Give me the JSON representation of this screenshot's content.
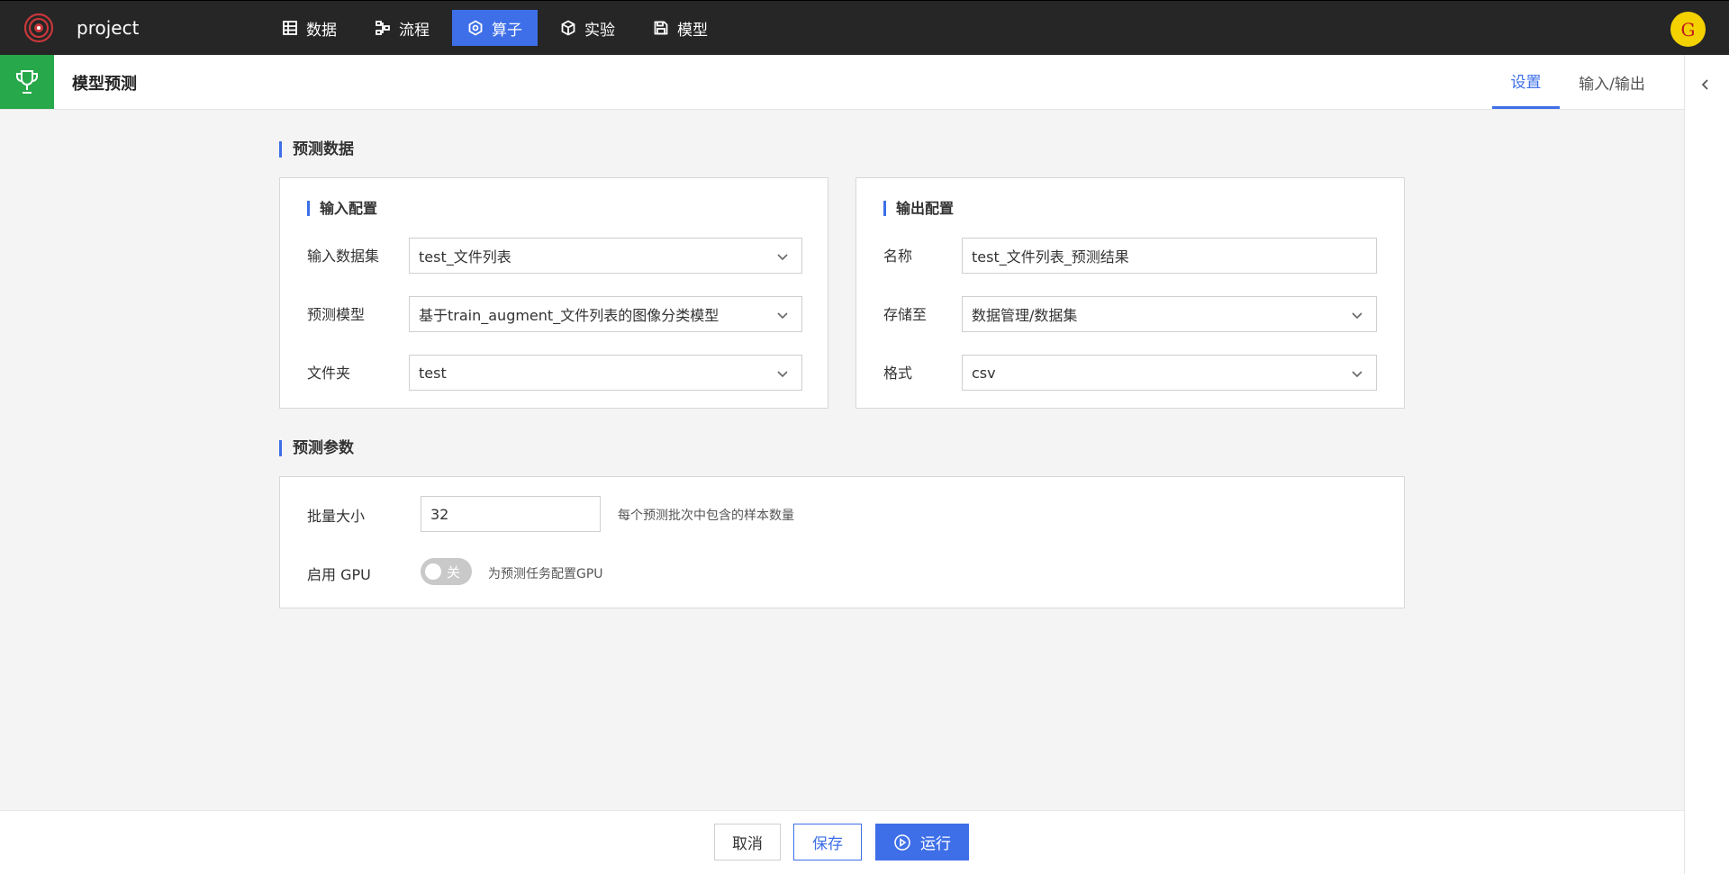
{
  "app": {
    "project_name": "project",
    "avatar_letter": "G"
  },
  "nav": {
    "items": [
      {
        "label": "数据",
        "icon": "table-icon"
      },
      {
        "label": "流程",
        "icon": "flow-icon"
      },
      {
        "label": "算子",
        "icon": "hexagon-icon",
        "active": true
      },
      {
        "label": "实验",
        "icon": "cube-icon"
      },
      {
        "label": "模型",
        "icon": "save-icon"
      }
    ]
  },
  "header": {
    "title": "模型预测",
    "tabs": {
      "settings": "设置",
      "io": "输入/输出"
    }
  },
  "predict_data": {
    "section_title": "预测数据",
    "input_config": {
      "title": "输入配置",
      "dataset_label": "输入数据集",
      "dataset_value": "test_文件列表",
      "model_label": "预测模型",
      "model_value": "基于train_augment_文件列表的图像分类模型",
      "folder_label": "文件夹",
      "folder_value": "test"
    },
    "output_config": {
      "title": "输出配置",
      "name_label": "名称",
      "name_value": "test_文件列表_预测结果",
      "store_label": "存储至",
      "store_value": "数据管理/数据集",
      "format_label": "格式",
      "format_value": "csv"
    }
  },
  "predict_params": {
    "section_title": "预测参数",
    "batch_label": "批量大小",
    "batch_value": "32",
    "batch_hint": "每个预测批次中包含的样本数量",
    "gpu_label": "启用 GPU",
    "gpu_toggle_text": "关",
    "gpu_enabled": false,
    "gpu_hint": "为预测任务配置GPU"
  },
  "footer": {
    "cancel": "取消",
    "save": "保存",
    "run": "运行"
  },
  "colors": {
    "accent": "#3e6fe8",
    "topbar": "#262626",
    "trophy_bg": "#27a84a",
    "avatar_bg": "#f3d200"
  }
}
